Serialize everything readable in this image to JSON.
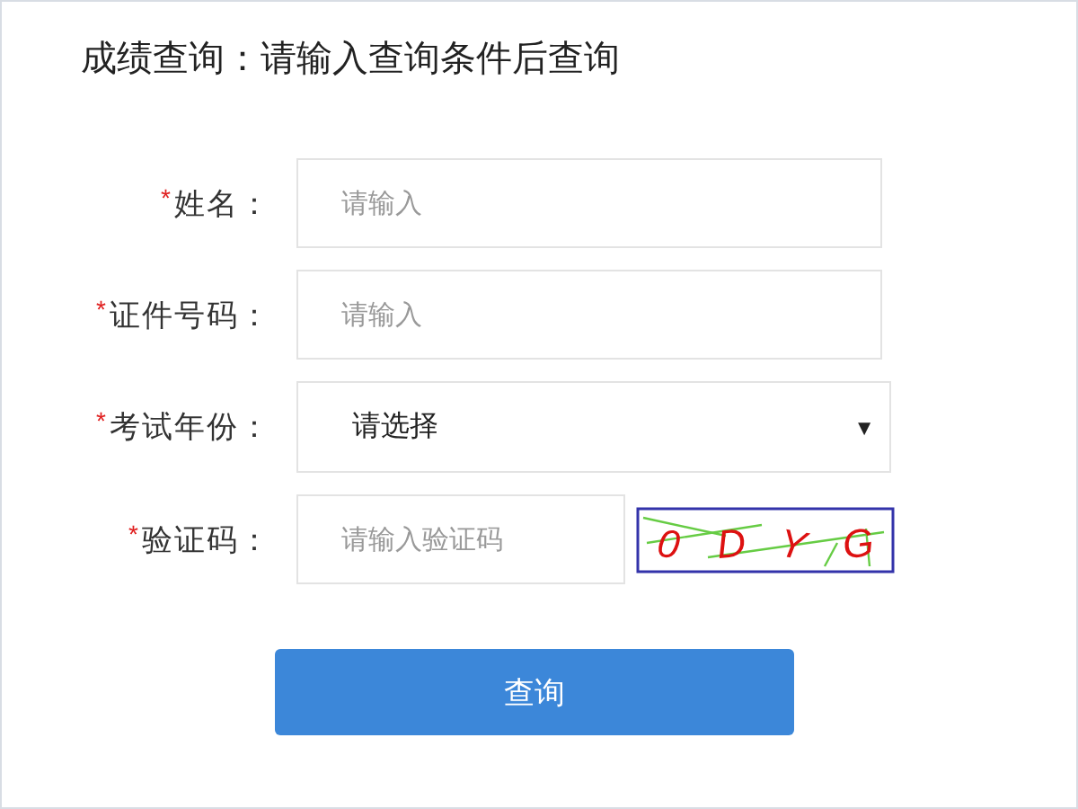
{
  "title": "成绩查询：请输入查询条件后查询",
  "fields": [
    {
      "kind": "text",
      "required_mark": "*",
      "label": "姓名：",
      "placeholder": "请输入"
    },
    {
      "kind": "text",
      "required_mark": "*",
      "label": "证件号码：",
      "placeholder": "请输入"
    },
    {
      "kind": "select",
      "required_mark": "*",
      "label": "考试年份：",
      "value": "请选择",
      "arrow": "▼"
    },
    {
      "kind": "captcha",
      "required_mark": "*",
      "label": "验证码：",
      "placeholder": "请输入验证码",
      "captcha_characters": [
        "0",
        "D",
        "Y",
        "G"
      ]
    }
  ],
  "submit": "查询"
}
